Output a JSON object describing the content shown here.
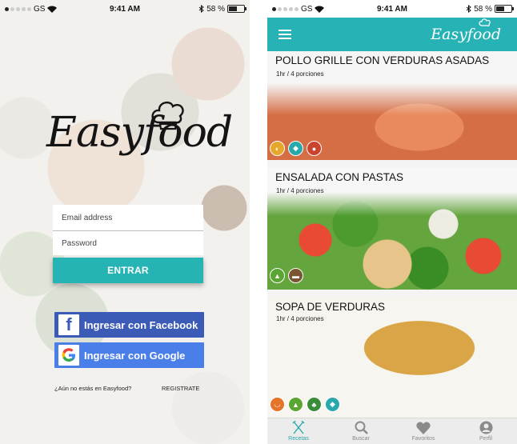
{
  "login": {
    "status": {
      "carrier": "GS",
      "time": "9:41 AM",
      "battery": "58 %",
      "battery_level": 0.58
    },
    "logo": "Easyfood",
    "email_placeholder": "Email address",
    "password_placeholder": "Password",
    "enter_label": "ENTRAR",
    "facebook_label": "Ingresar con Facebook",
    "google_label": "Ingresar con Google",
    "signup_prompt": "¿Aún no estás en Easyfood?",
    "signup_link": "REGISTRATE"
  },
  "feed": {
    "status": {
      "carrier": "GS",
      "time": "9:41 AM",
      "battery": "58 %",
      "battery_level": 0.58
    },
    "brand": "Easyfood",
    "recipes": [
      {
        "title": "POLLO GRILLE CON VERDURAS ASADAS",
        "meta": "1hr / 4 porciones",
        "tags": [
          "lemon-icon",
          "fish-icon",
          "meat-icon"
        ]
      },
      {
        "title": "ENSALADA CON PASTAS",
        "meta": "1hr / 4 porciones",
        "tags": [
          "carrot-icon",
          "bread-icon"
        ]
      },
      {
        "title": "SOPA DE VERDURAS",
        "meta": "1hr / 4 porciones",
        "tags": [
          "bowl-icon",
          "carrot-icon",
          "broccoli-icon",
          "fish-icon"
        ]
      }
    ],
    "tabs": [
      {
        "label": "Recetas",
        "icon": "utensils-icon"
      },
      {
        "label": "Buscar",
        "icon": "search-icon"
      },
      {
        "label": "Favoritos",
        "icon": "heart-icon"
      },
      {
        "label": "Perfil",
        "icon": "profile-icon"
      }
    ],
    "colors": {
      "accent": "#27b2b5",
      "facebook": "#3b5bb7",
      "google": "#4a7fe9"
    }
  }
}
